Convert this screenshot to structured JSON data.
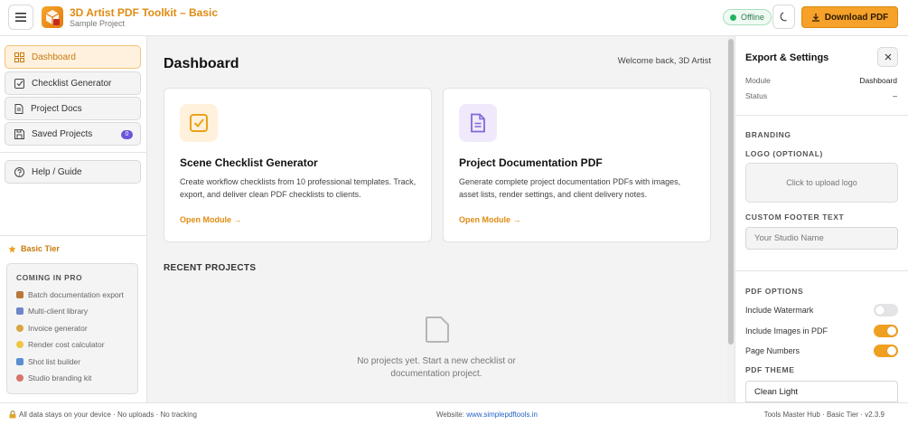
{
  "header": {
    "app_title": "3D Artist PDF Toolkit – Basic",
    "app_subtitle": "Sample Project",
    "status": "Offline",
    "download_label": "Download PDF",
    "accent_color": "#f5a12a"
  },
  "sidebar": {
    "items": [
      {
        "label": "Dashboard",
        "icon": "grid-icon",
        "active": true
      },
      {
        "label": "Checklist Generator",
        "icon": "checkbox-icon"
      },
      {
        "label": "Project Docs",
        "icon": "document-icon"
      },
      {
        "label": "Saved Projects",
        "icon": "save-icon",
        "badge": "0"
      }
    ],
    "help_label": "Help / Guide",
    "tier_label": "Basic Tier",
    "pro": {
      "title": "COMING IN PRO",
      "items": [
        "Batch documentation export",
        "Multi-client library",
        "Invoice generator",
        "Render cost calculator",
        "Shot list builder",
        "Studio branding kit"
      ]
    }
  },
  "main": {
    "title": "Dashboard",
    "welcome": "Welcome back, 3D Artist",
    "cards": [
      {
        "title": "Scene Checklist Generator",
        "description": "Create workflow checklists from 10 professional templates. Track, export, and deliver clean PDF checklists to clients.",
        "link": "Open Module →"
      },
      {
        "title": "Project Documentation PDF",
        "description": "Generate complete project documentation PDFs with images, asset lists, render settings, and client delivery notes.",
        "link": "Open Module →"
      }
    ],
    "recent_title": "RECENT PROJECTS",
    "empty_text": "No projects yet. Start a new checklist or documentation project."
  },
  "panel": {
    "title": "Export & Settings",
    "module_key": "Module",
    "module_value": "Dashboard",
    "status_key": "Status",
    "status_value": "–",
    "branding_title": "BRANDING",
    "logo_label": "LOGO (OPTIONAL)",
    "upload_text": "Click to upload logo",
    "footer_label": "CUSTOM FOOTER TEXT",
    "footer_placeholder": "Your Studio Name",
    "pdf_options_title": "PDF OPTIONS",
    "toggles": [
      {
        "label": "Include Watermark",
        "on": false
      },
      {
        "label": "Include Images in PDF",
        "on": true
      },
      {
        "label": "Page Numbers",
        "on": true
      }
    ],
    "theme_label": "PDF THEME",
    "theme_value": "Clean Light"
  },
  "footer": {
    "left": "All data stays on your device · No uploads · No tracking",
    "website_label": "Website:",
    "website_link": "www.simplepdftools.in",
    "right": "Tools Master Hub · Basic Tier · v2.3.9"
  }
}
